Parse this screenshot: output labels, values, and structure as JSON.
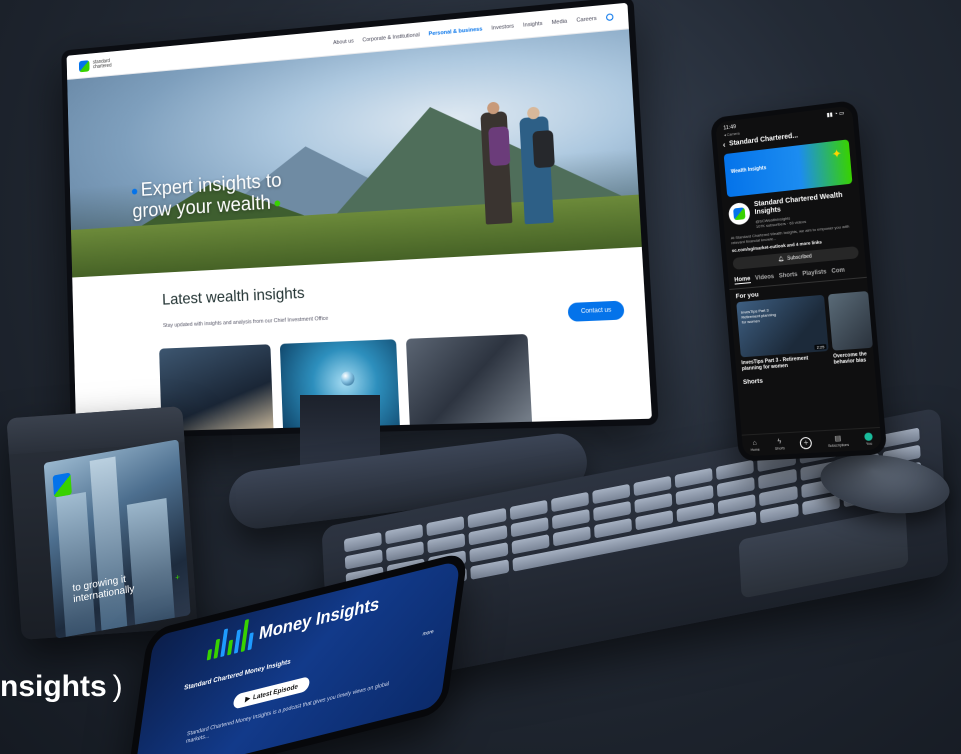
{
  "site": {
    "logo_text": "standard chartered",
    "nav": [
      {
        "label": "About us",
        "active": false
      },
      {
        "label": "Corporate & Institutional",
        "active": false
      },
      {
        "label": "Personal & business",
        "active": true
      },
      {
        "label": "Investors",
        "active": false
      },
      {
        "label": "Insights",
        "active": false
      },
      {
        "label": "Media",
        "active": false
      },
      {
        "label": "Careers",
        "active": false
      }
    ],
    "hero_headline": "Expert insights to grow your wealth",
    "section_title": "Latest wealth insights",
    "section_subtitle": "Stay updated with insights and analysis from our Chief Investment Office",
    "contact_button": "Contact us"
  },
  "phone": {
    "time": "11:49",
    "status_sub": "◂ Camera",
    "header_title": "Standard Chartered...",
    "banner_text": "Wealth Insights",
    "channel_name": "Standard Chartered Wealth Insights",
    "channel_handle": "@SCWealthInsights",
    "channel_stats": "107K subscribers · 63 videos",
    "channel_desc": "At Standard Chartered Wealth Insights, we aim to empower you with relevant financial knowle...",
    "channel_link": "sc.com/sg/market-outlook and 4 more links",
    "subscribe_label": "Subscribed",
    "tabs": [
      "Home",
      "Videos",
      "Shorts",
      "Playlists",
      "Com"
    ],
    "for_you_label": "For you",
    "video_overlay": "InvesTips Part 3 Retirement planning for women",
    "video_duration": "2:25",
    "video_title_1": "InvesTips Part 3 - Retirement planning for women",
    "video_title_2": "Overcome the behavior bias",
    "shorts_label": "Shorts",
    "bottom_nav": [
      {
        "label": "Home",
        "icon": "home-icon",
        "glyph": "⌂"
      },
      {
        "label": "Shorts",
        "icon": "shorts-icon",
        "glyph": "ϟ"
      },
      {
        "label": "",
        "icon": "create-icon",
        "glyph": "+"
      },
      {
        "label": "Subscriptions",
        "icon": "subscriptions-icon",
        "glyph": "▤"
      },
      {
        "label": "You",
        "icon": "you-avatar-icon",
        "glyph": ""
      }
    ]
  },
  "box": {
    "text": "to growing it internationally",
    "plus": "+"
  },
  "flat_phone": {
    "title": "Money Insights",
    "heading": "Standard Chartered Money Insights",
    "button_label": "Latest Episode",
    "description": "Standard Chartered Money Insights is a podcast that gives you timely views on global markets...",
    "more_label": "more"
  },
  "caption": {
    "text": "nsights",
    "paren": ")"
  },
  "colors": {
    "brand_blue": "#0473ea",
    "brand_green": "#38d200"
  }
}
